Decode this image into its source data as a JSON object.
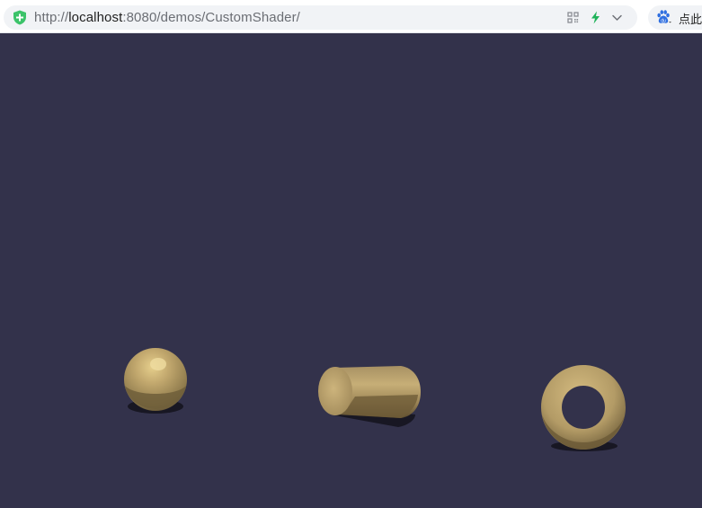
{
  "address_bar": {
    "scheme": "http://",
    "host": "localhost",
    "path": ":8080/demos/CustomShader/"
  },
  "search": {
    "text": "点此"
  },
  "icons": {
    "security": "shield-plus-icon",
    "qr": "qr-code-icon",
    "speed": "lightning-icon",
    "dropdown": "chevron-down-icon",
    "search_engine": "baidu-paw-icon"
  },
  "colors": {
    "viewport_background": "#33324b",
    "shield": "#3cc36a",
    "bolt": "#20b35a",
    "paw": "#2f6fe0",
    "material": "#b79f68"
  },
  "scene": {
    "objects": [
      {
        "name": "sphere",
        "type": "sphere"
      },
      {
        "name": "cylinder",
        "type": "cylinder"
      },
      {
        "name": "torus",
        "type": "torus"
      }
    ]
  }
}
